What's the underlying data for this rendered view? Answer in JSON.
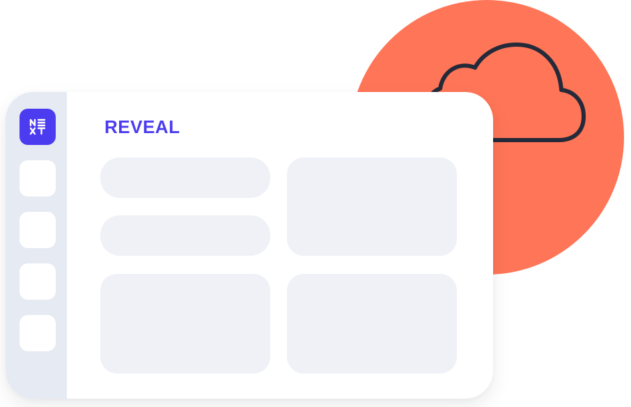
{
  "brand": {
    "title": "REVEAL",
    "logo": {
      "icon": "next-logo-icon",
      "color": "#4b3cf0"
    }
  },
  "theme": {
    "accent": "#ff7557",
    "accent_icon": "cloud-icon"
  },
  "sidebar": {
    "items": [
      {
        "icon": "blank-nav-item"
      },
      {
        "icon": "blank-nav-item"
      },
      {
        "icon": "blank-nav-item"
      },
      {
        "icon": "blank-nav-item"
      }
    ]
  }
}
